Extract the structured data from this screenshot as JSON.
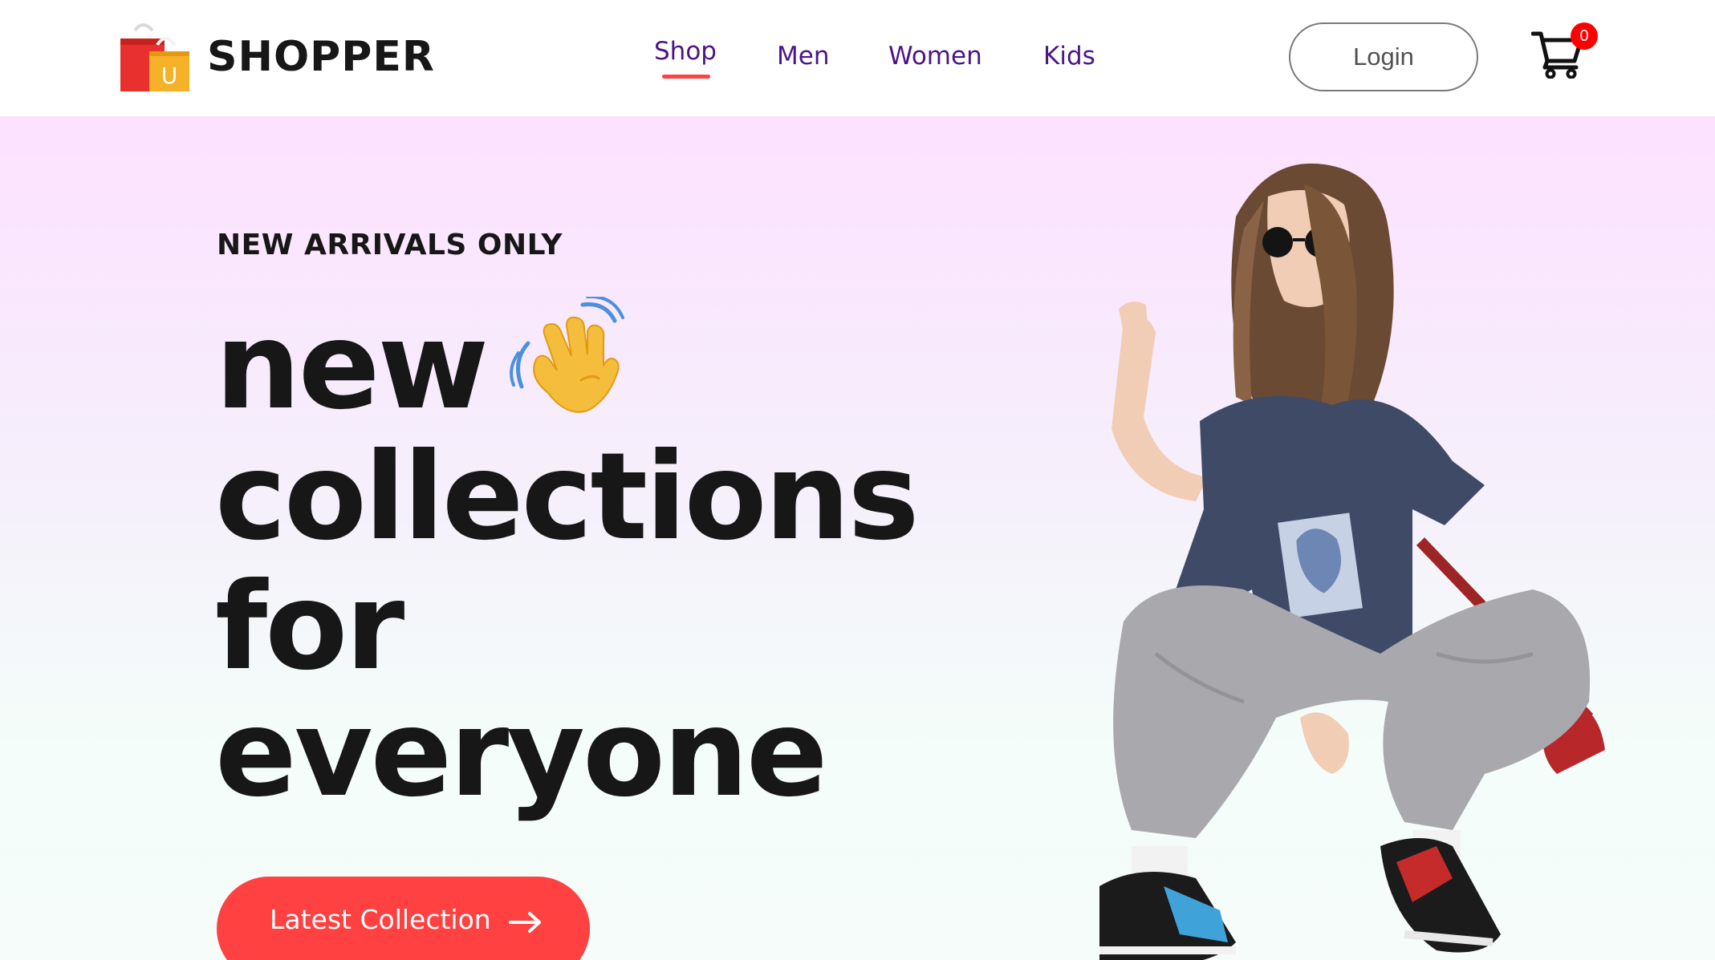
{
  "brand": {
    "name": "SHOPPER",
    "logo_icon": "shopping-bags-icon",
    "logo_letter": "U"
  },
  "nav": {
    "items": [
      {
        "label": "Shop",
        "active": true
      },
      {
        "label": "Men"
      },
      {
        "label": "Women"
      },
      {
        "label": "Kids"
      }
    ],
    "login_label": "Login",
    "cart_icon": "cart-icon",
    "cart_count": "0"
  },
  "hero": {
    "tagline": "NEW ARRIVALS ONLY",
    "headline": [
      "new",
      "collections",
      "for",
      "everyone"
    ],
    "wave_icon": "waving-hand-icon",
    "cta_label": "Latest Collection",
    "cta_icon": "arrow-right-icon",
    "image": "hero-model-image"
  },
  "colors": {
    "accent": "#ff4141",
    "nav_text": "#4b1586",
    "heading": "#171717",
    "hero_gradient_top": "#fde1ff",
    "hero_gradient_bottom": "#f5fcf9",
    "cart_badge": "#ff0000"
  }
}
